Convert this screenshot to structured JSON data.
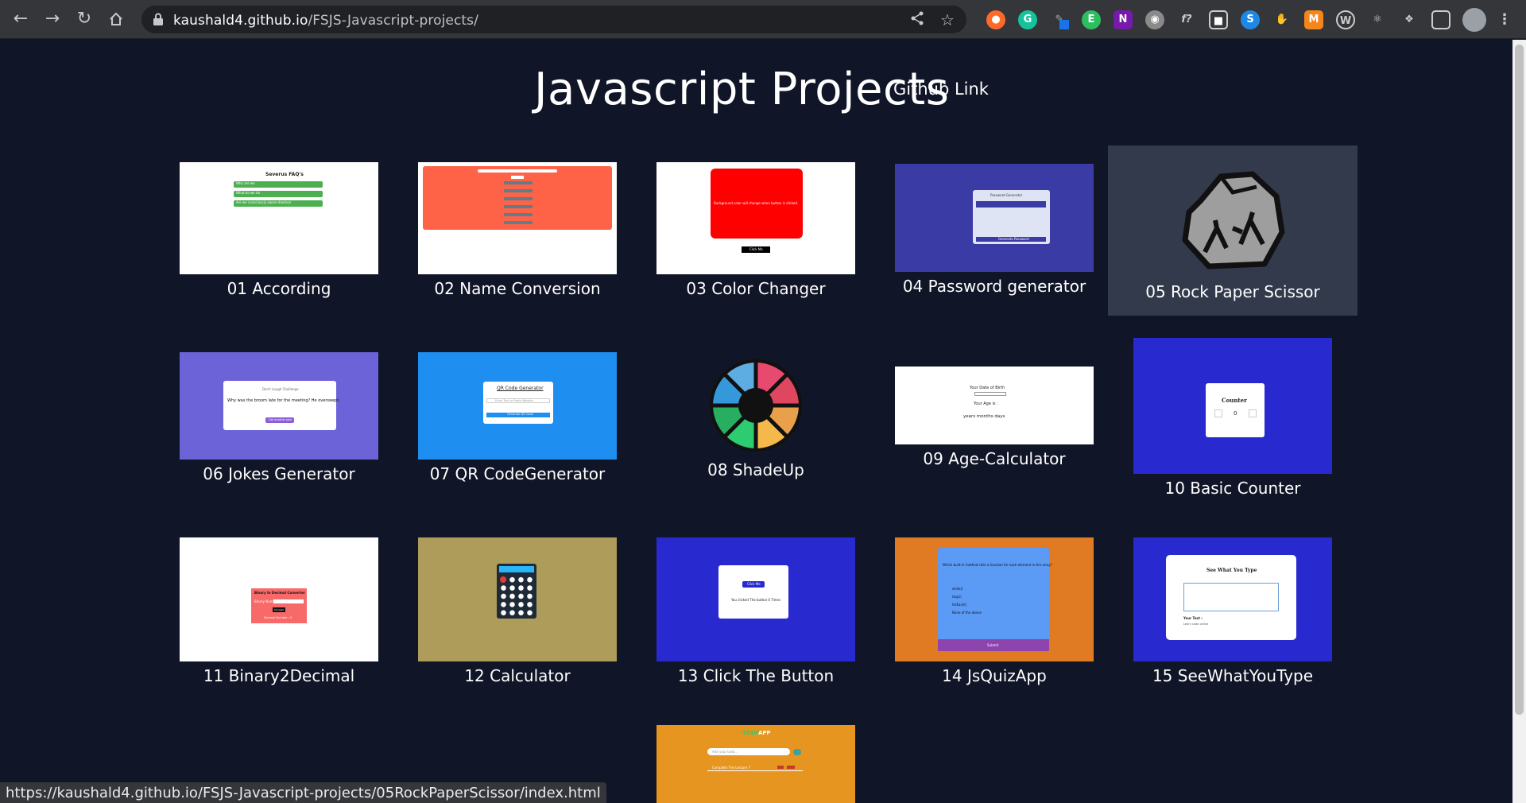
{
  "browser": {
    "url_host": "kaushald4.github.io",
    "url_path": "/FSJS-Javascript-projects/",
    "status_url": "https://kaushald4.github.io/FSJS-Javascript-projects/05RockPaperScissor/index.html"
  },
  "page": {
    "title": "Javascript Projects",
    "github_link": "Github Link"
  },
  "projects": [
    {
      "caption": "01 According",
      "preview": {
        "heading": "Severus FAQ's",
        "items": [
          "Who are we",
          "What do we do",
          "Are we consciously aware daemon"
        ]
      }
    },
    {
      "caption": "02 Name Conversion"
    },
    {
      "caption": "03 Color Changer",
      "preview": {
        "text": "Background color will change when button is clicked.",
        "button": "Click Me"
      }
    },
    {
      "caption": "04 Password generator",
      "preview": {
        "heading": "Password Generator",
        "button": "Generate Password"
      }
    },
    {
      "caption": "05 Rock Paper Scissor"
    },
    {
      "caption": "06 Jokes Generator",
      "preview": {
        "heading": "Don't Laugh Challenge",
        "question": "Why was the broom late for the meeting? He overswept.",
        "button": "Get another joke"
      }
    },
    {
      "caption": "07 QR CodeGenerator",
      "preview": {
        "heading": "QR Code Generator",
        "input": "Enter Text or Paste Website",
        "button": "Generate QR Code"
      }
    },
    {
      "caption": "08 ShadeUp"
    },
    {
      "caption": "09 Age-Calculator",
      "preview": {
        "dob": "Your Date of Birth",
        "age": "Your Age is :",
        "result": "years months days"
      }
    },
    {
      "caption": "10 Basic Counter",
      "preview": {
        "heading": "Counter",
        "value": "0"
      }
    },
    {
      "caption": "11 Binary2Decimal",
      "preview": {
        "heading": "Binary to Decimal Converter",
        "label": "Binary Number",
        "button": "Convert",
        "result": "Decimal Number : 0"
      }
    },
    {
      "caption": "12 Calculator"
    },
    {
      "caption": "13 Click The Button",
      "preview": {
        "button": "Click Me",
        "text": "You clicked The button 0 Times"
      }
    },
    {
      "caption": "14 JsQuizApp",
      "preview": {
        "question": "Which built-in method calls a function for each element in the array?",
        "options": [
          "while()",
          "loop()",
          "forEach()",
          "None of the above"
        ],
        "button": "Submit"
      }
    },
    {
      "caption": "15 SeeWhatYouType",
      "preview": {
        "heading": "See What You Type",
        "label": "Your Text :",
        "placeholder": "Learn code online"
      }
    },
    {
      "caption": "",
      "preview": {
        "logo_a": "TODO",
        "logo_b": "APP",
        "input": "Add your todo...",
        "item": "Complete The Lecture 7"
      }
    }
  ],
  "colors": {
    "background": "#101527",
    "hover_card": "#323a4c",
    "text": "#ffffff"
  }
}
